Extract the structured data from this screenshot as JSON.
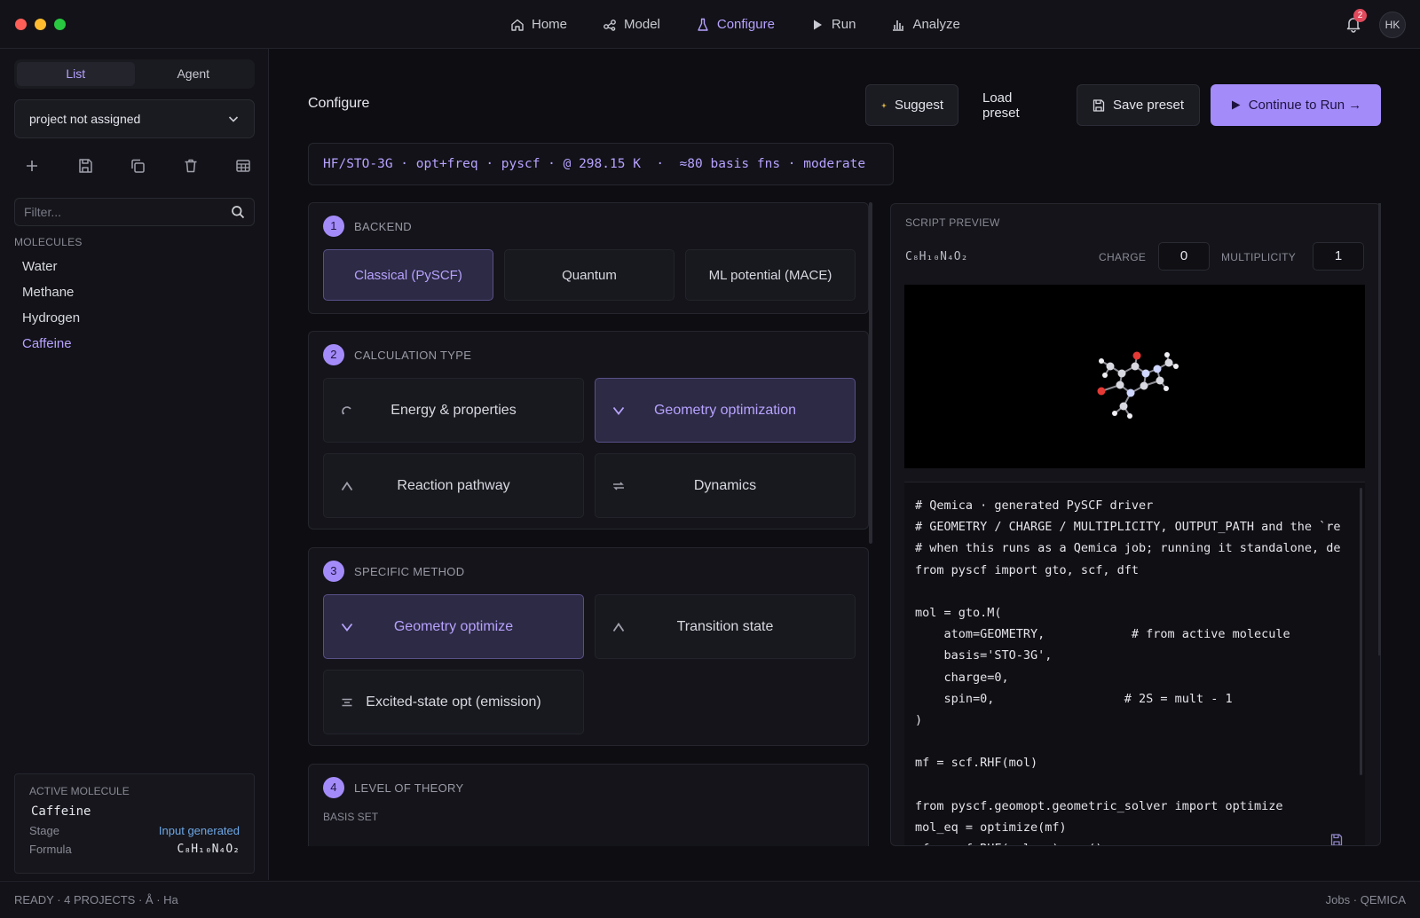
{
  "nav": {
    "items": [
      {
        "label": "Home",
        "icon": "home-icon"
      },
      {
        "label": "Model",
        "icon": "share-icon"
      },
      {
        "label": "Configure",
        "icon": "flask-icon"
      },
      {
        "label": "Run",
        "icon": "play-icon"
      },
      {
        "label": "Analyze",
        "icon": "bar-chart-icon"
      }
    ],
    "active": "Configure",
    "notification_count": "2",
    "avatar_initials": "HK"
  },
  "sidebar": {
    "tabs": [
      "List",
      "Agent"
    ],
    "active_tab": "List",
    "project_select": "project not assigned",
    "toolbar_icons": [
      "plus-icon",
      "save-icon",
      "copy-icon",
      "trash-icon",
      "table-icon"
    ],
    "filter_placeholder": "Filter...",
    "molecules_heading": "MOLECULES",
    "molecules": [
      "Water",
      "Methane",
      "Hydrogen",
      "Caffeine"
    ],
    "active_molecule_index": 3,
    "active_card": {
      "title": "ACTIVE MOLECULE",
      "name": "Caffeine",
      "stage_label": "Stage",
      "stage_value": "Input generated",
      "formula_label": "Formula",
      "formula_value": "C₈H₁₀N₄O₂"
    }
  },
  "main": {
    "title": "Configure",
    "buttons": {
      "suggest": "Suggest",
      "load_preset": "Load preset",
      "save_preset": "Save preset",
      "continue": "Continue to Run →"
    },
    "summary": "HF/STO-3G · opt+freq · pyscf · @ 298.15 K  ·  ≈80 basis fns · moderate",
    "sections": {
      "backend": {
        "number": "1",
        "title": "BACKEND",
        "options": [
          "Classical (PySCF)",
          "Quantum",
          "ML potential (MACE)"
        ],
        "selected": 0
      },
      "calc_type": {
        "number": "2",
        "title": "CALCULATION TYPE",
        "options": [
          {
            "label": "Energy & properties",
            "icon": "arc-icon"
          },
          {
            "label": "Geometry optimization",
            "icon": "chevron-down-icon"
          },
          {
            "label": "Reaction pathway",
            "icon": "caret-up-icon"
          },
          {
            "label": "Dynamics",
            "icon": "waves-icon"
          }
        ],
        "selected": 1
      },
      "specific_method": {
        "number": "3",
        "title": "SPECIFIC METHOD",
        "options": [
          {
            "label": "Geometry optimize",
            "icon": "chevron-down-icon"
          },
          {
            "label": "Transition state",
            "icon": "caret-up-icon"
          },
          {
            "label": "Excited-state opt (emission)",
            "icon": "bar-icon"
          }
        ],
        "selected": 0
      },
      "level_of_theory": {
        "number": "4",
        "title": "LEVEL OF THEORY",
        "basis_label": "BASIS SET"
      }
    }
  },
  "preview": {
    "title": "SCRIPT PREVIEW",
    "formula": "C₈H₁₀N₄O₂",
    "charge_label": "CHARGE",
    "charge_value": "0",
    "multiplicity_label": "MULTIPLICITY",
    "multiplicity_value": "1",
    "code": "# Qemica · generated PySCF driver\n# GEOMETRY / CHARGE / MULTIPLICITY, OUTPUT_PATH and the `re\n# when this runs as a Qemica job; running it standalone, de\nfrom pyscf import gto, scf, dft\n\nmol = gto.M(\n    atom=GEOMETRY,            # from active molecule\n    basis='STO-3G',\n    charge=0,\n    spin=0,                  # 2S = mult - 1\n)\n\nmf = scf.RHF(mol)\n\nfrom pyscf.geomopt.geometric_solver import optimize\nmol_eq = optimize(mf)\nmf = scf.RHF(mol_eq).run()"
  },
  "status": {
    "ready": "READY",
    "projects": "4 PROJECTS",
    "units_length": "Å",
    "units_energy": "Ha",
    "jobs": "Jobs",
    "brand": "QEMICA"
  },
  "colors": {
    "accent": "#a48bfa",
    "accent_text": "#b7a2ff",
    "background": "#0d0d12",
    "panel": "#14141a",
    "stage_blue": "#6ea7e6",
    "badge_red": "#e04a5c"
  }
}
